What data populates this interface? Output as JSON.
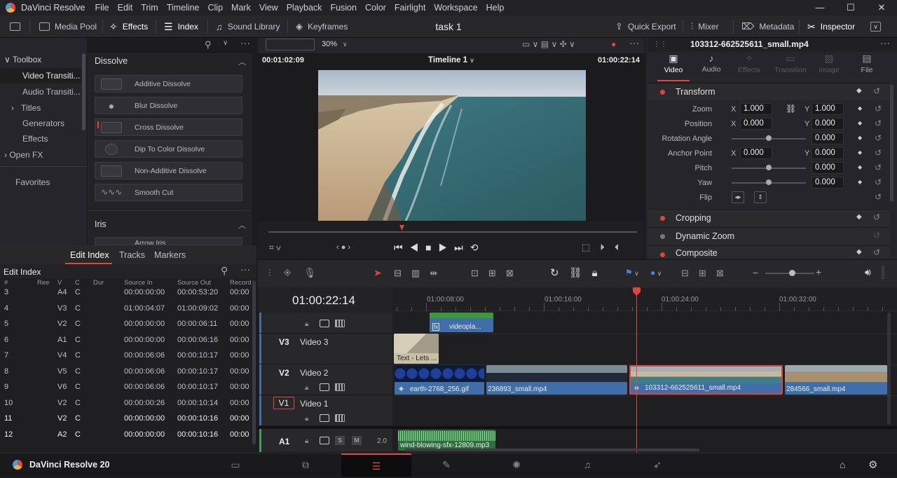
{
  "app": {
    "title": "DaVinci Resolve",
    "brand": "DaVinci Resolve 20"
  },
  "menu": [
    "File",
    "Edit",
    "Trim",
    "Timeline",
    "Clip",
    "Mark",
    "View",
    "Playback",
    "Fusion",
    "Color",
    "Fairlight",
    "Workspace",
    "Help"
  ],
  "window_controls": {
    "min": "—",
    "max": "☐",
    "close": "✕"
  },
  "toolbar": {
    "media_pool": "Media Pool",
    "effects": "Effects",
    "index": "Index",
    "sound_library": "Sound Library",
    "keyframes": "Keyframes",
    "project": "task 1",
    "quick_export": "Quick Export",
    "mixer": "Mixer",
    "metadata": "Metadata",
    "inspector": "Inspector"
  },
  "toolbox": {
    "items": [
      {
        "label": "Toolbox",
        "arrow": "∨"
      },
      {
        "label": "Video Transiti..."
      },
      {
        "label": "Audio Transiti..."
      },
      {
        "label": "Titles",
        "arrow": "›"
      },
      {
        "label": "Generators"
      },
      {
        "label": "Effects"
      },
      {
        "label": "Open FX",
        "arrow": "›"
      }
    ],
    "favorites": "Favorites"
  },
  "effects_list": {
    "section": "Dissolve",
    "items": [
      "Additive Dissolve",
      "Blur Dissolve",
      "Cross Dissolve",
      "Dip To Color Dissolve",
      "Non-Additive Dissolve",
      "Smooth Cut"
    ],
    "iris": "Iris",
    "iris_first": "Arrow Iris"
  },
  "index_tabs": [
    "Edit Index",
    "Tracks",
    "Markers"
  ],
  "edit_index": {
    "title": "Edit Index",
    "columns": [
      "#",
      "Ree",
      "V",
      "C",
      "Dur",
      "Source In",
      "Source Out",
      "Record"
    ],
    "rows": [
      [
        "3",
        "",
        "A4",
        "C",
        "",
        "00:00:00:00",
        "00:00:53:20",
        "00:00"
      ],
      [
        "4",
        "",
        "V3",
        "C",
        "",
        "01:00:04:07",
        "01:00:09:02",
        "00:00"
      ],
      [
        "5",
        "",
        "V2",
        "C",
        "",
        "00:00:00:00",
        "00:00:06:11",
        "00:00"
      ],
      [
        "6",
        "",
        "A1",
        "C",
        "",
        "00:00:00:00",
        "00:00:06:16",
        "00:00"
      ],
      [
        "7",
        "",
        "V4",
        "C",
        "",
        "00:00:06:06",
        "00:00:10:17",
        "00:00"
      ],
      [
        "8",
        "",
        "V5",
        "C",
        "",
        "00:00:06:06",
        "00:00:10:17",
        "00:00"
      ],
      [
        "9",
        "",
        "V6",
        "C",
        "",
        "00:00:06:06",
        "00:00:10:17",
        "00:00"
      ],
      [
        "10",
        "",
        "V2",
        "C",
        "",
        "00:00:00:26",
        "00:00:10:14",
        "00:00"
      ],
      [
        "11",
        "",
        "V2",
        "C",
        "",
        "00:00:00:00",
        "00:00:10:16",
        "00:00"
      ],
      [
        "12",
        "",
        "A2",
        "C",
        "",
        "00:00:00:00",
        "00:00:10:16",
        "00:00"
      ]
    ]
  },
  "viewer": {
    "zoom": "30%",
    "source_tc": "00:01:02:09",
    "timeline": "Timeline 1",
    "record_tc": "01:00:22:14"
  },
  "inspector": {
    "clip": "103312-662525611_small.mp4",
    "tabs": [
      "Video",
      "Audio",
      "Effects",
      "Transition",
      "Image",
      "File"
    ],
    "transform": "Transform",
    "zoom_label": "Zoom",
    "zoom_x": "1.000",
    "zoom_y": "1.000",
    "position_label": "Position",
    "pos_x": "0.000",
    "pos_y": "0.000",
    "rotation_label": "Rotation Angle",
    "rotation": "0.000",
    "anchor_label": "Anchor Point",
    "anchor_x": "0.000",
    "anchor_y": "0.000",
    "pitch_label": "Pitch",
    "pitch": "0.000",
    "yaw_label": "Yaw",
    "yaw": "0.000",
    "flip_label": "Flip",
    "axis_x": "X",
    "axis_y": "Y",
    "sections": [
      "Cropping",
      "Dynamic Zoom",
      "Composite"
    ]
  },
  "timeline": {
    "timecode": "01:00:22:14",
    "ruler": [
      "01:00:08:00",
      "01:00:16:00",
      "01:00:24:00",
      "01:00:32:00"
    ],
    "tracks": [
      {
        "id": "V3",
        "name": "Video 3"
      },
      {
        "id": "V2",
        "name": "Video 2"
      },
      {
        "id": "V1",
        "name": "Video 1"
      },
      {
        "id": "A1",
        "name": "",
        "level": "2.0"
      }
    ],
    "clips": {
      "video_top": "videopla...",
      "text_clip": "Text - Lets ...",
      "earth": "earth-2768_256.gif",
      "c236": "236893_small.mp4",
      "c103": "103312-662525611_small.mp4",
      "c284": "284566_small.mp4",
      "audio": "wind-blowing-sfx-12809.mp3"
    }
  },
  "pages": [
    "media",
    "cut",
    "edit",
    "fusion",
    "color",
    "fairlight",
    "deliver"
  ],
  "colors": {
    "accent_red": "#e0443c",
    "clip_blue": "#3f6ea8",
    "selected_border": "#e0443c"
  }
}
